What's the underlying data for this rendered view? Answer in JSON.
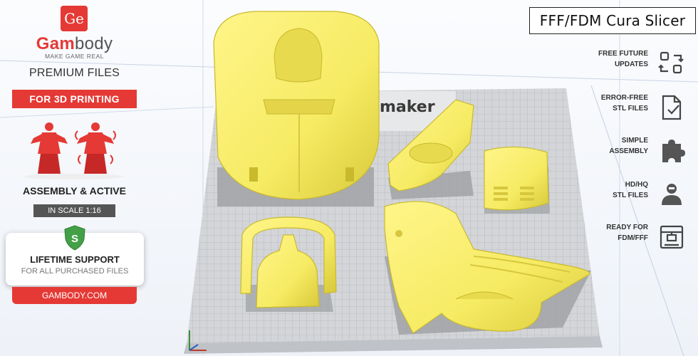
{
  "header": {
    "title": "FFF/FDM Cura Slicer"
  },
  "plate": {
    "printer_logo_text": "maker"
  },
  "brand": {
    "badge": "Ge",
    "name_part1": "Gam",
    "name_part2": "body",
    "tagline": "MAKE GAME REAL",
    "premium": "PREMIUM FILES",
    "for_3d": "FOR 3D PRINTING",
    "assembly": "ASSEMBLY & ACTIVE",
    "scale": "IN SCALE 1:16",
    "support_title": "LIFETIME SUPPORT",
    "support_sub": "FOR ALL PURCHASED FILES",
    "shield_letter": "S",
    "website": "GAMBODY.COM"
  },
  "features": [
    {
      "line1": "FREE FUTURE",
      "line2": "UPDATES",
      "icon": "refresh-icon"
    },
    {
      "line1": "ERROR-FREE",
      "line2": "STL FILES",
      "icon": "file-check-icon"
    },
    {
      "line1": "SIMPLE",
      "line2": "ASSEMBLY",
      "icon": "puzzle-icon"
    },
    {
      "line1": "HD/HQ",
      "line2": "STL FILES",
      "icon": "person-icon"
    },
    {
      "line1": "READY FOR",
      "line2": "FDM/FFF",
      "icon": "printer-icon"
    }
  ],
  "colors": {
    "brand_red": "#e53935",
    "model_yellow": "#f6eb63",
    "plate_grey": "#d3d5d8"
  }
}
